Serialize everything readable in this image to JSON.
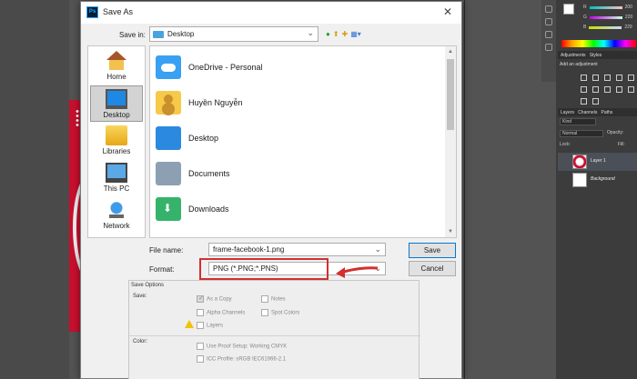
{
  "dialog": {
    "title": "Save As",
    "app_icon": "Ps",
    "close": "✕"
  },
  "save_in": {
    "label": "Save in:",
    "value": "Desktop"
  },
  "places": [
    {
      "label": "Home",
      "icon": "home-icon"
    },
    {
      "label": "Desktop",
      "icon": "desktop-icon",
      "selected": true
    },
    {
      "label": "Libraries",
      "icon": "libraries-icon"
    },
    {
      "label": "This PC",
      "icon": "this-pc-icon"
    },
    {
      "label": "Network",
      "icon": "network-icon"
    }
  ],
  "files": [
    {
      "name": "OneDrive - Personal",
      "icon": "onedrive-folder-icon"
    },
    {
      "name": "Huyền Nguyễn",
      "icon": "user-folder-icon"
    },
    {
      "name": "Desktop",
      "icon": "desktop-folder-icon"
    },
    {
      "name": "Documents",
      "icon": "documents-folder-icon"
    },
    {
      "name": "Downloads",
      "icon": "downloads-folder-icon"
    }
  ],
  "file_name": {
    "label": "File name:",
    "value": "frame-facebook-1.png"
  },
  "format": {
    "label": "Format:",
    "value": "PNG (*.PNG;*.PNS)"
  },
  "buttons": {
    "save": "Save",
    "cancel": "Cancel"
  },
  "save_options": {
    "header": "Save Options",
    "save_label": "Save:",
    "as_a_copy": "As a Copy",
    "notes": "Notes",
    "alpha_channels": "Alpha Channels",
    "spot_colors": "Spot Colors",
    "layers": "Layers",
    "color_label": "Color:",
    "use_proof_setup": "Use Proof Setup:  Working CMYK",
    "icc_profile": "ICC Profile:  sRGB IEC61966-2.1"
  },
  "ps_panels": {
    "r": "R",
    "g": "G",
    "b": "B",
    "r_val": "200",
    "g_val": "220",
    "b_val": "229",
    "tab_adjustments": "Adjustments",
    "tab_styles": "Styles",
    "add_adjustment": "Add an adjustment",
    "tab_layers": "Layers",
    "tab_channels": "Channels",
    "tab_paths": "Paths",
    "kind": "Kind",
    "normal": "Normal",
    "opacity": "Opacity:",
    "lock": "Lock:",
    "fill": "Fill:",
    "layer1": "Layer 1",
    "background": "Background"
  },
  "colors": {
    "highlight": "#d32f2f",
    "ps_dark": "#3c3c3c",
    "dialog_bg": "#f0f0f0"
  }
}
